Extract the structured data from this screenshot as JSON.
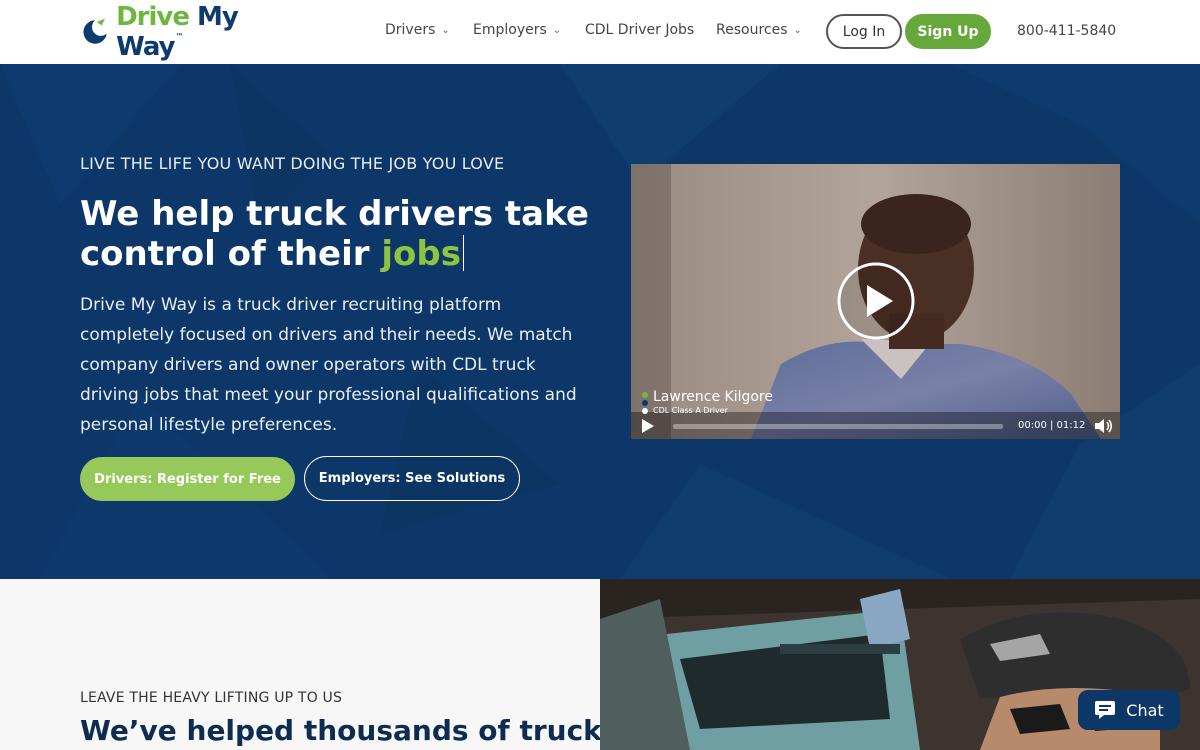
{
  "brand": {
    "logo_text_drive": "Drive",
    "logo_text_my_way": "My Way",
    "logo_tm": "™"
  },
  "nav": {
    "items": [
      {
        "label": "Drivers",
        "dropdown": true
      },
      {
        "label": "Employers",
        "dropdown": true
      },
      {
        "label": "CDL Driver Jobs",
        "dropdown": false
      },
      {
        "label": "Resources",
        "dropdown": true
      }
    ],
    "login_label": "Log In",
    "signup_label": "Sign Up",
    "phone": "800-411-5840"
  },
  "hero": {
    "eyebrow": "LIVE THE LIFE YOU WANT DOING THE JOB YOU LOVE",
    "headline_part1": "We help truck drivers take control of their",
    "headline_highlight": "jobs",
    "description": "Drive My Way is a truck driver recruiting platform completely focused on drivers and their needs. We match company drivers and owner operators with CDL truck driving jobs that meet your professional qualifications and personal lifestyle preferences.",
    "cta_drivers": "Drivers: Register for Free",
    "cta_employers": "Employers: See Solutions"
  },
  "video": {
    "person_name": "Lawrence Kilgore",
    "person_role": "CDL Class A Driver",
    "time_display": "00:00 | 01:12",
    "progress_fraction": 0
  },
  "section2": {
    "eyebrow": "LEAVE THE HEAVY LIFTING UP TO US",
    "headline": "We’ve helped thousands of truck"
  },
  "chat": {
    "label": "Chat"
  },
  "colors": {
    "brand_green": "#6cb83f",
    "brand_navy": "#0d3768",
    "cta_green": "#97c95a",
    "signup_green": "#66a83a"
  },
  "icons": [
    "chevron-down-icon",
    "play-icon",
    "volume-icon",
    "chat-icon"
  ]
}
